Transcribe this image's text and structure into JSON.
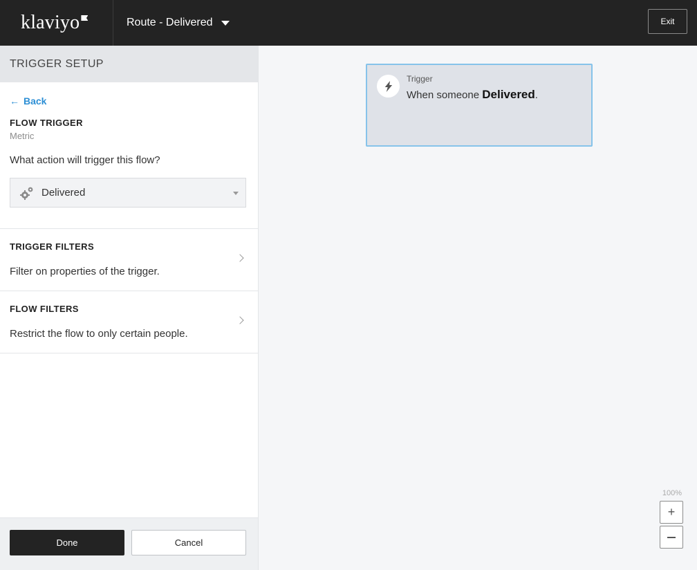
{
  "header": {
    "logo_text": "klaviyo",
    "flow_name": "Route - Delivered",
    "exit_label": "Exit"
  },
  "sidebar": {
    "title": "TRIGGER SETUP",
    "back_label": "Back",
    "flow_trigger": {
      "heading": "FLOW TRIGGER",
      "type": "Metric",
      "question": "What action will trigger this flow?",
      "selected_metric": "Delivered",
      "metric_icon": "gears-icon"
    },
    "trigger_filters": {
      "heading": "TRIGGER FILTERS",
      "description": "Filter on properties of the trigger."
    },
    "flow_filters": {
      "heading": "FLOW FILTERS",
      "description": "Restrict the flow to only certain people."
    },
    "done_label": "Done",
    "cancel_label": "Cancel"
  },
  "canvas": {
    "card": {
      "label": "Trigger",
      "text_prefix": "When someone ",
      "metric": "Delivered",
      "text_suffix": ".",
      "icon": "lightning-bolt-icon"
    },
    "zoom_level": "100%",
    "zoom_in_label": "+",
    "accent_color": "#2d8fd5"
  }
}
